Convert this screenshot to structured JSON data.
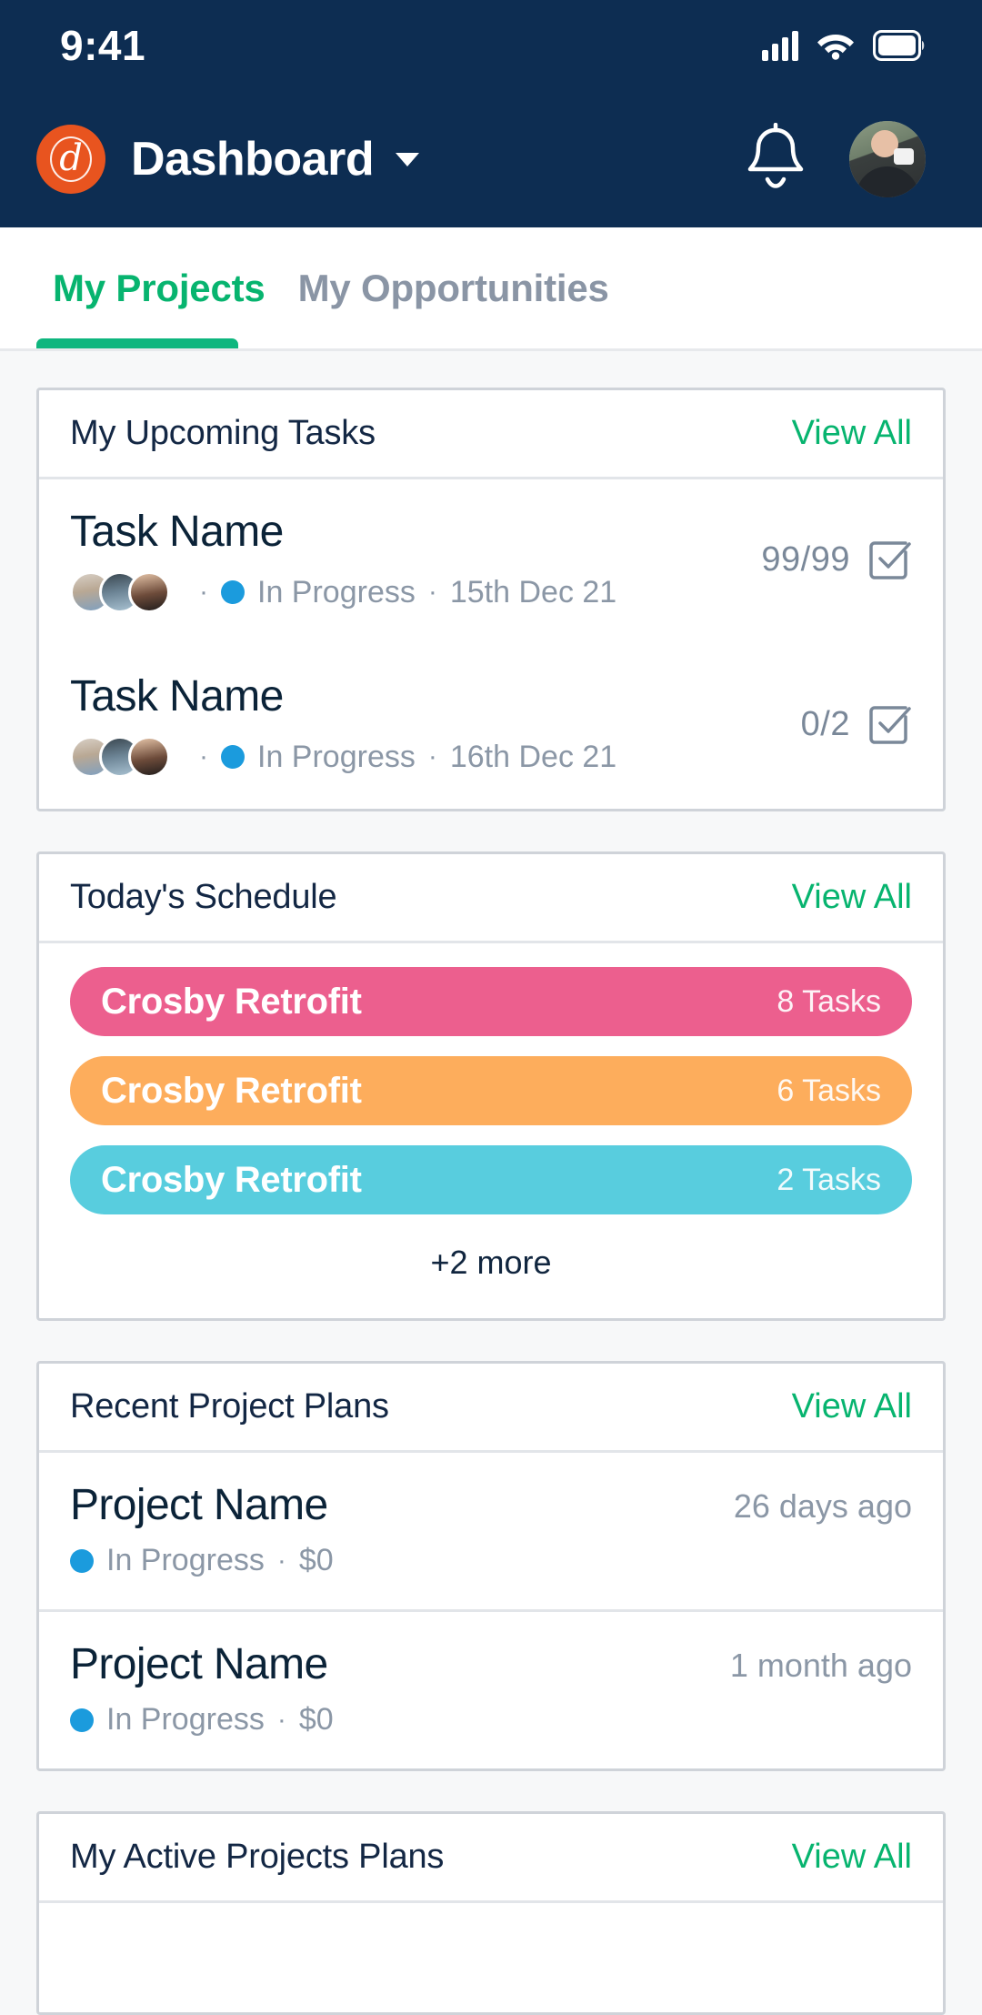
{
  "statusbar": {
    "time": "9:41",
    "icons": [
      "signal-icon",
      "wifi-icon",
      "battery-icon"
    ]
  },
  "appbar": {
    "logo_icon": "app-logo-icon",
    "logo_glyph": "d",
    "title": "Dashboard",
    "caret_icon": "chevron-down-icon",
    "bell_icon": "notification-bell-icon",
    "avatar_icon": "user-avatar"
  },
  "colors": {
    "header_navy": "#0d2d52",
    "accent_green": "#07b46f",
    "status_blue": "#1b9bdd",
    "logo_orange": "#e8541f",
    "bar_pink": "#ec5f8e",
    "bar_orange": "#fdad5c",
    "bar_cyan": "#58cdde",
    "muted_text": "#8b97a6",
    "page_bg": "#f7f8f9",
    "card_border": "#cfd3d9"
  },
  "tabs": [
    {
      "label": "My Projects",
      "active": true
    },
    {
      "label": "My Opportunities",
      "active": false
    }
  ],
  "cards": {
    "upcoming_tasks": {
      "title": "My Upcoming Tasks",
      "view_all": "View All",
      "rows": [
        {
          "name": "Task Name",
          "status": "In Progress",
          "date": "15th Dec 21",
          "count": "99/99",
          "checkbox_icon": "checkbox-checked-icon",
          "separator": "·",
          "avatars": 3
        },
        {
          "name": "Task Name",
          "status": "In Progress",
          "date": "16th Dec 21",
          "count": "0/2",
          "checkbox_icon": "checkbox-checked-icon",
          "separator": "·",
          "avatars": 3
        }
      ]
    },
    "todays_schedule": {
      "title": "Today's Schedule",
      "view_all": "View All",
      "bars": [
        {
          "name": "Crosby Retrofit",
          "count": "8 Tasks",
          "color": "#ec5f8e"
        },
        {
          "name": "Crosby Retrofit",
          "count": "6 Tasks",
          "color": "#fdad5c"
        },
        {
          "name": "Crosby Retrofit",
          "count": "2 Tasks",
          "color": "#58cdde"
        }
      ],
      "more_label": "+2 more"
    },
    "recent_project_plans": {
      "title": "Recent Project Plans",
      "view_all": "View All",
      "rows": [
        {
          "name": "Project Name",
          "ago": "26 days ago",
          "status": "In Progress",
          "separator": "·",
          "amount": "$0"
        },
        {
          "name": "Project Name",
          "ago": "1 month ago",
          "status": "In Progress",
          "separator": "·",
          "amount": "$0"
        }
      ]
    },
    "active_project_plans": {
      "title": "My Active Projects Plans",
      "view_all": "View All"
    }
  }
}
